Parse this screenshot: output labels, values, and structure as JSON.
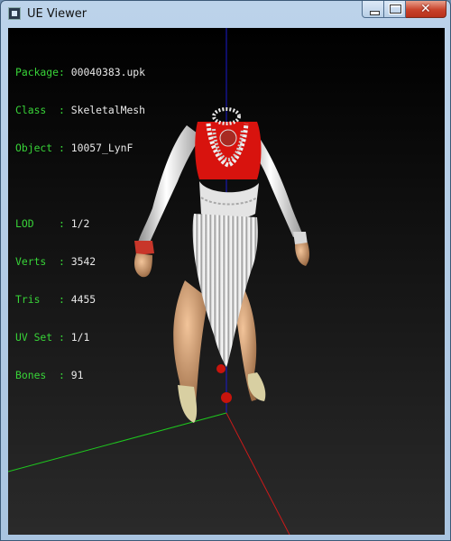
{
  "window": {
    "title": "UE Viewer"
  },
  "caption_buttons": {
    "minimize": "minimize",
    "maximize": "maximize",
    "close": "close"
  },
  "info": {
    "package_label": "Package:",
    "package": "00040383.upk",
    "class_label": "Class  :",
    "class": "SkeletalMesh",
    "object_label": "Object :",
    "object": "10057_LynF",
    "lod_label": "LOD    :",
    "lod": "1/2",
    "verts_label": "Verts  :",
    "verts": "3542",
    "tris_label": "Tris   :",
    "tris": "4455",
    "uvset_label": "UV Set :",
    "uvset": "1/1",
    "bones_label": "Bones  :",
    "bones": "91"
  },
  "colors": {
    "label_green": "#38d438",
    "axis_x": "#cc1a1a",
    "axis_y": "#1ec81e",
    "axis_z": "#1a1acc",
    "outfit_red": "#d8130e",
    "outfit_white": "#e6e6e6"
  }
}
